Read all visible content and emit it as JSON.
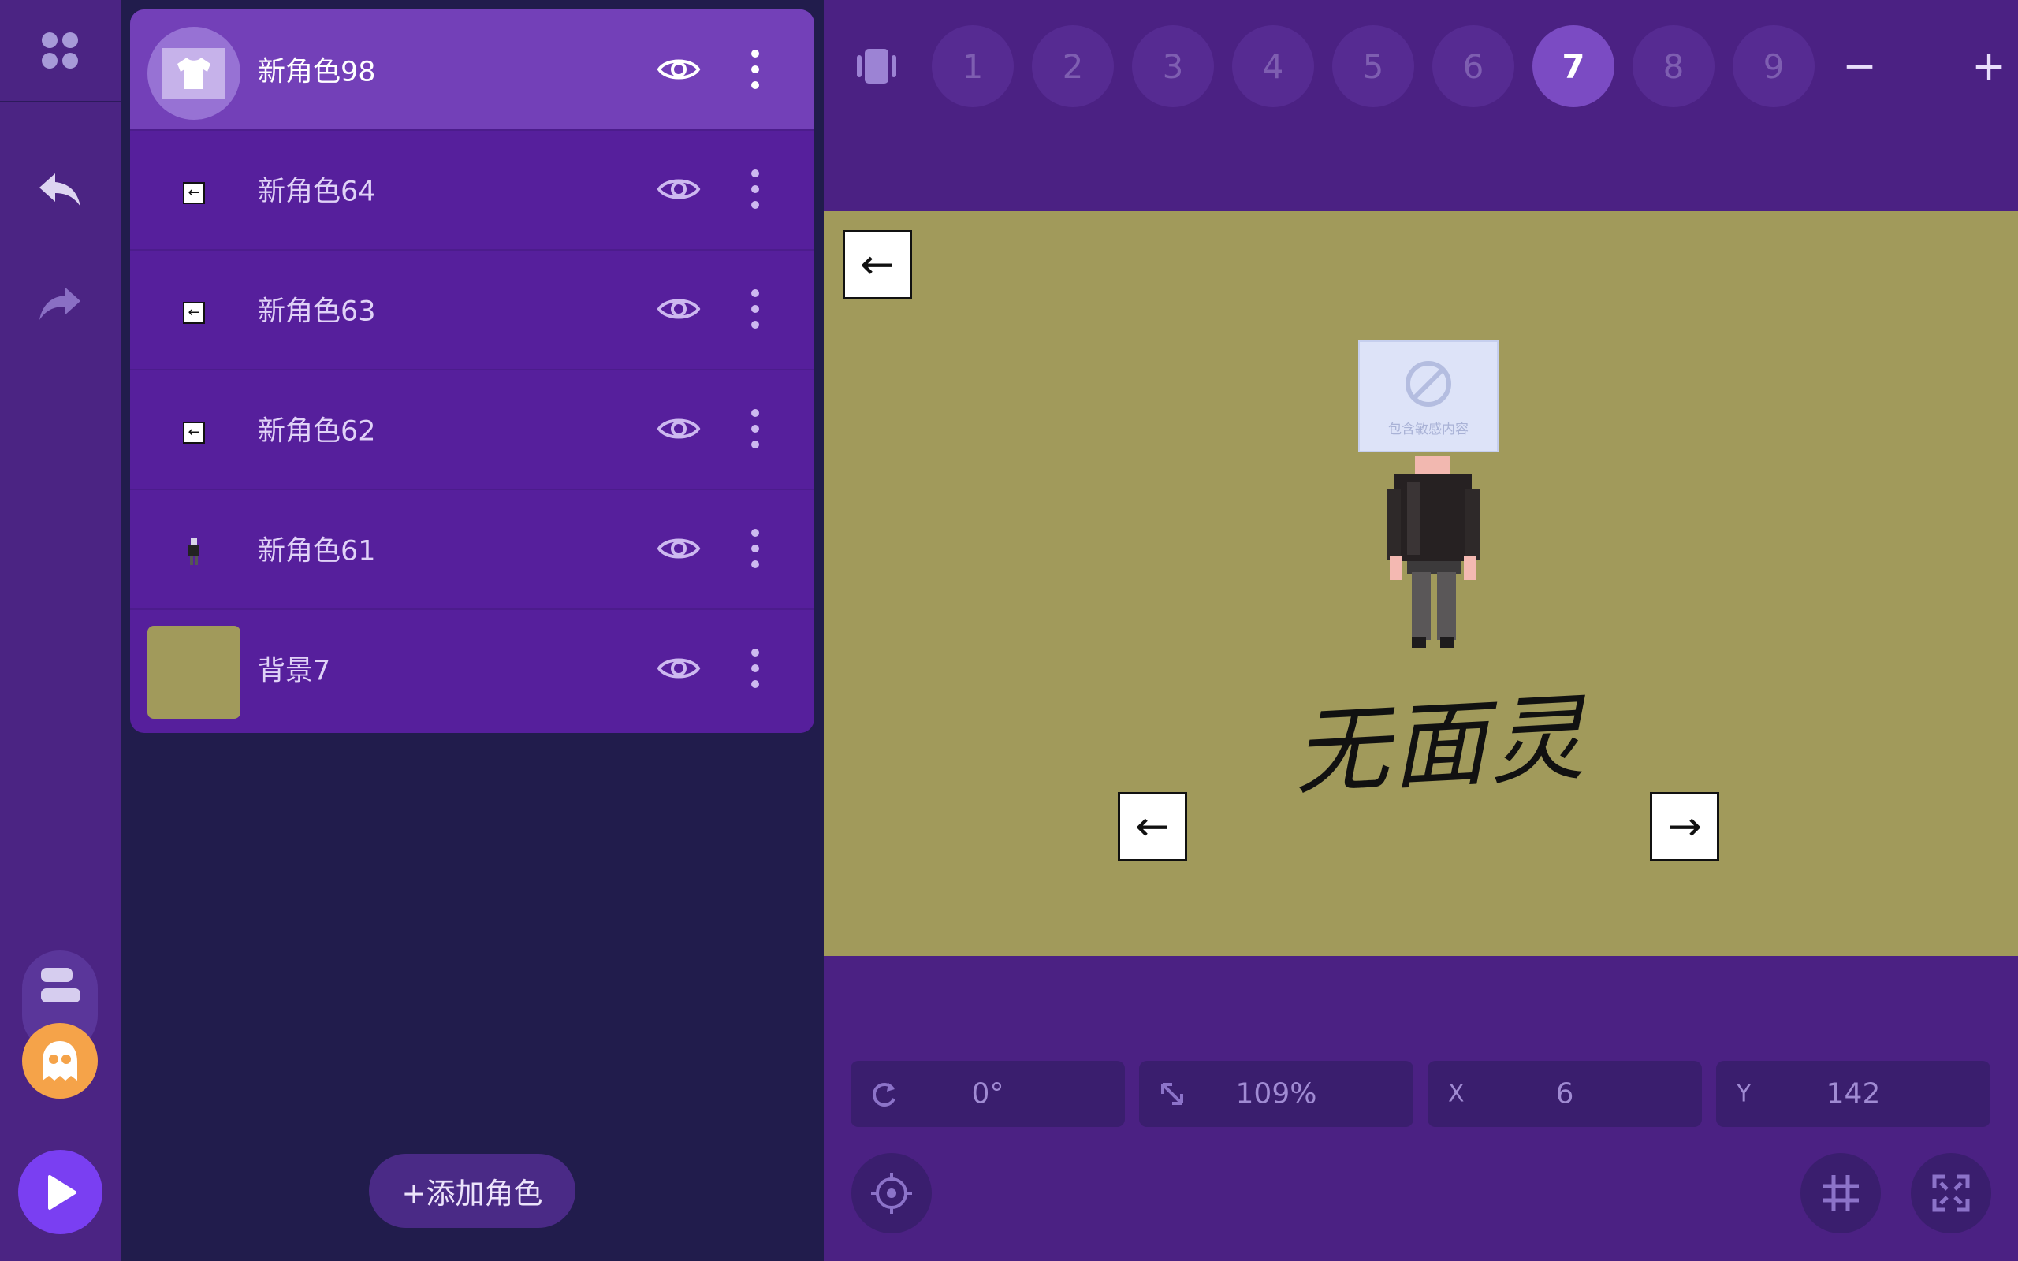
{
  "sidebar": {
    "menu_icon": "grid-icon",
    "undo_icon": "undo-icon",
    "redo_icon": "redo-icon",
    "blocks_icon": "blocks-icon",
    "avatar_icon": "ghost-avatar-icon",
    "play_icon": "play-icon"
  },
  "roles": [
    {
      "name": "新角色98",
      "thumb": "shirt-icon",
      "selected": true
    },
    {
      "name": "新角色64",
      "thumb": "left-arrow-key-icon"
    },
    {
      "name": "新角色63",
      "thumb": "left-arrow-key-icon"
    },
    {
      "name": "新角色62",
      "thumb": "left-arrow-key-icon"
    },
    {
      "name": "新角色61",
      "thumb": "character-sprite-icon"
    },
    {
      "name": "背景7",
      "thumb": "background-swatch",
      "color": "#a19a5b"
    }
  ],
  "add_role_label": "+添加角色",
  "pages": [
    "1",
    "2",
    "3",
    "4",
    "5",
    "6",
    "7",
    "8",
    "9"
  ],
  "active_page": "7",
  "page_controls": {
    "minus": "−",
    "plus": "+"
  },
  "stage": {
    "background_color": "#a19a5b",
    "title_text": "无面灵",
    "sensitive_label": "包含敏感内容",
    "arrow_left": "←",
    "arrow_right": "→"
  },
  "transform": {
    "rotation": "0°",
    "scale": "109%",
    "x_label": "X",
    "x_value": "6",
    "y_label": "Y",
    "y_value": "142"
  },
  "colors": {
    "rail": "#4b2483",
    "panel": "#211c4c",
    "list": "#561f9c",
    "selected_row": "#7340b8",
    "accent_orange": "#f5a349",
    "play": "#7a3ff2"
  }
}
